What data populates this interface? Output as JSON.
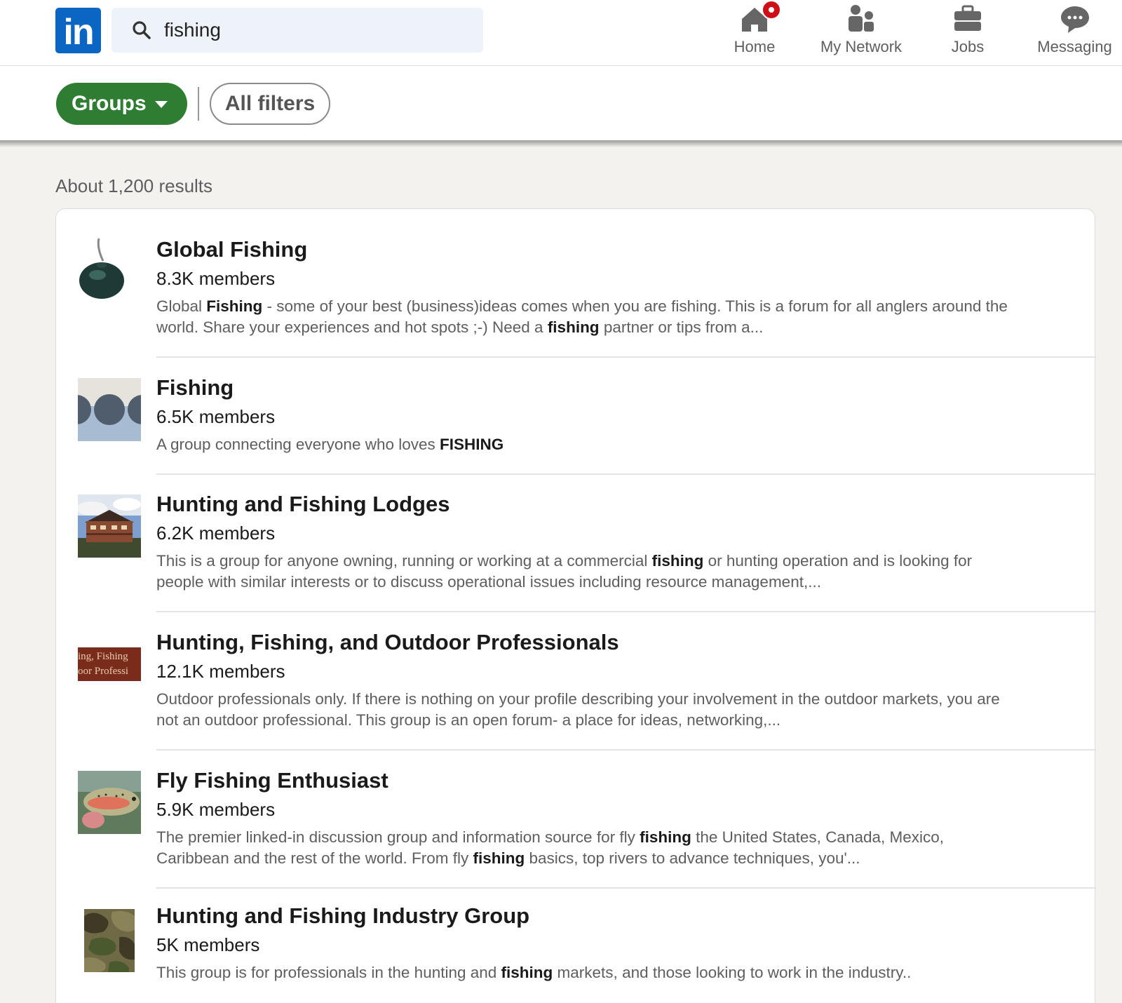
{
  "brand": {
    "logo_text": "in",
    "color": "#0a66c2"
  },
  "search": {
    "query": "fishing",
    "icon": "search-icon"
  },
  "nav": [
    {
      "label": "Home",
      "icon": "home-icon",
      "has_notification": true
    },
    {
      "label": "My Network",
      "icon": "network-icon"
    },
    {
      "label": "Jobs",
      "icon": "briefcase-icon"
    },
    {
      "label": "Messaging",
      "icon": "messaging-icon"
    }
  ],
  "filters": {
    "groups_label": "Groups",
    "all_filters_label": "All filters",
    "active_color": "#2e7d32"
  },
  "results": {
    "count_text": "About 1,200 results",
    "items": [
      {
        "title": "Global Fishing",
        "members": "8.3K members",
        "desc_parts": [
          [
            "Global ",
            false
          ],
          [
            "Fishing",
            true
          ],
          [
            " - some of your best (business)ideas comes when you are fishing. This is a forum for all anglers around the world. Share your experiences and hot spots ;-) Need a ",
            false
          ],
          [
            "fishing",
            true
          ],
          [
            " partner or tips from a...",
            false
          ]
        ],
        "thumb": "fishing-weight-image"
      },
      {
        "title": "Fishing",
        "members": "6.5K members",
        "desc_parts": [
          [
            "A group connecting everyone who loves ",
            false
          ],
          [
            "FISHING",
            true
          ]
        ],
        "thumb": "wave-pattern-logo"
      },
      {
        "title": "Hunting and Fishing Lodges",
        "members": "6.2K members",
        "desc_parts": [
          [
            "This is a group for anyone owning, running or working at a commercial ",
            false
          ],
          [
            "fishing",
            true
          ],
          [
            " or hunting operation and is looking for people with similar interests or to discuss operational issues including resource management,...",
            false
          ]
        ],
        "thumb": "lodge-photo"
      },
      {
        "title": "Hunting, Fishing, and Outdoor Professionals",
        "members": "12.1K members",
        "desc_parts": [
          [
            "Outdoor professionals only. If there is nothing on your profile describing your involvement in the outdoor markets, you are not an outdoor professional. This group is an open forum- a place for ideas, networking,...",
            false
          ]
        ],
        "thumb": "text-banner-logo",
        "thumb_text": [
          "ing, Fishing",
          "oor Professi"
        ]
      },
      {
        "title": "Fly Fishing Enthusiast",
        "members": "5.9K members",
        "desc_parts": [
          [
            "The premier linked-in discussion group and information source for fly ",
            false
          ],
          [
            "fishing",
            true
          ],
          [
            " the United States, Canada, Mexico, Caribbean and the rest of the world. From fly ",
            false
          ],
          [
            "fishing",
            true
          ],
          [
            " basics, top rivers to advance techniques, you'...",
            false
          ]
        ],
        "thumb": "trout-photo"
      },
      {
        "title": "Hunting and Fishing Industry Group",
        "members": "5K members",
        "desc_parts": [
          [
            "This group is for professionals in the hunting and ",
            false
          ],
          [
            "fishing",
            true
          ],
          [
            " markets, and those looking to work in the industry..",
            false
          ]
        ],
        "thumb": "camo-pattern"
      }
    ]
  }
}
